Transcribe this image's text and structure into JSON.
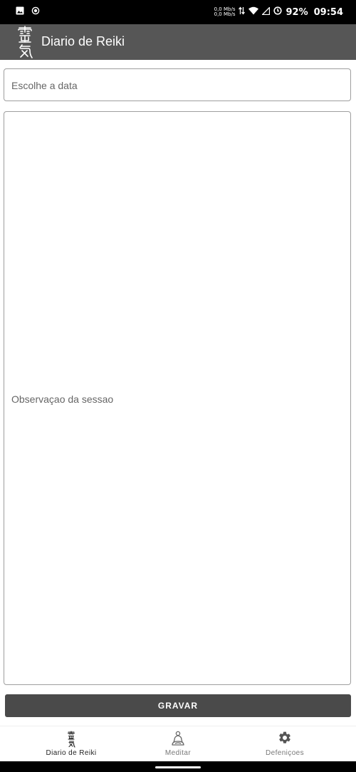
{
  "status_bar": {
    "net_speed_up": "0,0 Mb/s",
    "net_speed_down": "0,0 Mb/s",
    "battery": "92%",
    "time": "09:54",
    "icons": [
      "image-icon",
      "record-icon",
      "data-arrows-icon",
      "wifi-icon",
      "signal-icon",
      "battery-saver-icon"
    ]
  },
  "app_bar": {
    "logo_icon": "reiki-kanji-logo",
    "title": "Diario de Reiki",
    "background": "#565656"
  },
  "form": {
    "date_placeholder": "Escolhe a data",
    "notes_placeholder": "Observaçao da sessao",
    "save_label": "GRAVAR"
  },
  "bottom_nav": {
    "items": [
      {
        "label": "Diario de Reiki",
        "icon": "reiki-kanji-icon",
        "active": true
      },
      {
        "label": "Meditar",
        "icon": "meditation-icon",
        "active": false
      },
      {
        "label": "Defeniçoes",
        "icon": "gear-icon",
        "active": false
      }
    ]
  }
}
